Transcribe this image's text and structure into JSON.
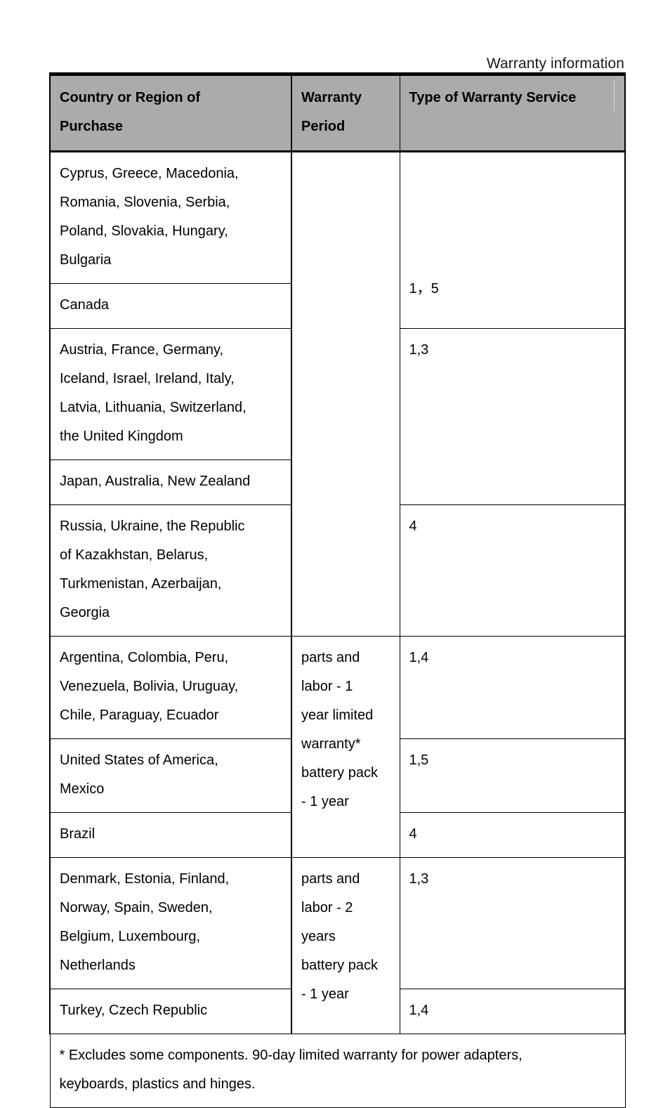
{
  "running_head": "Warranty information",
  "table": {
    "headers": {
      "country": "Country or Region of Purchase",
      "country_line1": "Country or Region of",
      "country_line2": "Purchase",
      "period": "Warranty Period",
      "period_line1": "Warranty",
      "period_line2": "Period",
      "service": "Type of Warranty Service"
    },
    "period_groups": {
      "merged_blank": "",
      "one_year": "parts and labor - 1 year limited warranty* battery pack - 1 year",
      "one_year_lines": [
        "parts and",
        "labor - 1",
        "year limited",
        "warranty*",
        "battery pack",
        "- 1 year"
      ],
      "two_year": "parts and labor - 2 years battery pack - 1 year",
      "two_year_lines": [
        "parts and",
        "labor - 2",
        "years",
        "battery pack",
        "- 1 year"
      ]
    },
    "rows": [
      {
        "countries": "Cyprus, Greece, Macedonia, Romania, Slovenia, Serbia, Poland, Slovakia, Hungary, Bulgaria",
        "country_lines": [
          "Cyprus, Greece, Macedonia,",
          "Romania, Slovenia, Serbia,",
          "Poland, Slovakia, Hungary,",
          "Bulgaria"
        ],
        "service": ""
      },
      {
        "countries": "Canada",
        "country_lines": [
          "Canada"
        ],
        "service": "1，5"
      },
      {
        "countries": "Austria, France, Germany, Iceland, Israel, Ireland, Italy, Latvia, Lithuania, Switzerland, the United Kingdom",
        "country_lines": [
          "Austria, France, Germany,",
          "Iceland, Israel, Ireland, Italy,",
          "Latvia, Lithuania, Switzerland,",
          "the United Kingdom"
        ],
        "service": "1,3"
      },
      {
        "countries": "Japan, Australia, New Zealand",
        "country_lines": [
          "Japan, Australia, New Zealand"
        ],
        "service": ""
      },
      {
        "countries": "Russia, Ukraine, the Republic of Kazakhstan, Belarus, Turkmenistan, Azerbaijan, Georgia",
        "country_lines": [
          "Russia, Ukraine, the Republic",
          "of Kazakhstan, Belarus,",
          "Turkmenistan, Azerbaijan,",
          "Georgia"
        ],
        "service": "4"
      },
      {
        "countries": "Argentina, Colombia, Peru, Venezuela, Bolivia, Uruguay, Chile, Paraguay, Ecuador",
        "country_lines": [
          "Argentina, Colombia, Peru,",
          "Venezuela, Bolivia, Uruguay,",
          "Chile, Paraguay, Ecuador"
        ],
        "service": "1,4"
      },
      {
        "countries": "United States of America, Mexico",
        "country_lines": [
          "United States of America,",
          "Mexico"
        ],
        "service": "1,5"
      },
      {
        "countries": "Brazil",
        "country_lines": [
          "Brazil"
        ],
        "service": "4"
      },
      {
        "countries": "Denmark, Estonia, Finland, Norway, Spain, Sweden, Belgium, Luxembourg, Netherlands",
        "country_lines": [
          "Denmark, Estonia, Finland,",
          "Norway, Spain, Sweden,",
          "Belgium, Luxembourg,",
          "Netherlands"
        ],
        "service": "1,3"
      },
      {
        "countries": "Turkey, Czech Republic",
        "country_lines": [
          "Turkey, Czech Republic"
        ],
        "service": "1,4"
      }
    ],
    "footnote": "* Excludes some components. 90-day limited warranty for power adapters, keyboards, plastics and hinges.",
    "footnote_lines": [
      "* Excludes some components. 90-day limited warranty for power adapters,",
      "keyboards, plastics and hinges."
    ]
  },
  "colors": {
    "header_fill": "#ababab",
    "border": "#000000",
    "text": "#000000",
    "page_background": "#ffffff"
  }
}
